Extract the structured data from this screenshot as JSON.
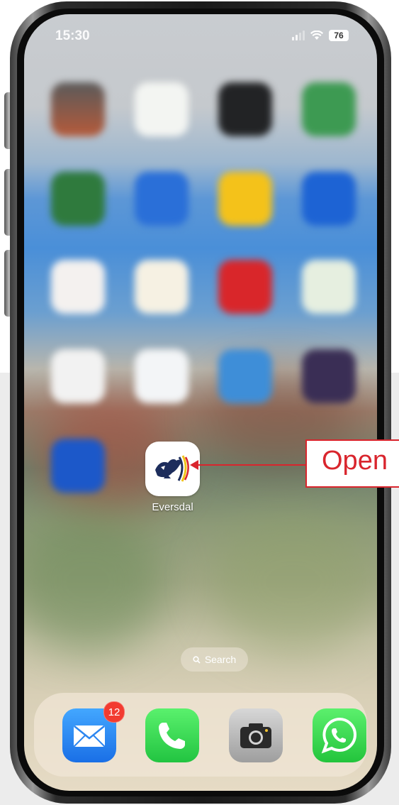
{
  "status_bar": {
    "time": "15:30",
    "battery": "76"
  },
  "home_screen": {
    "focused_app": {
      "label": "Eversdal"
    },
    "search_label": "Search"
  },
  "dock": {
    "apps": [
      {
        "icon": "mail-icon",
        "badge": "12"
      },
      {
        "icon": "phone-icon"
      },
      {
        "icon": "camera-icon"
      },
      {
        "icon": "whatsapp-icon"
      }
    ]
  },
  "annotation": {
    "text": "Open",
    "color": "#d9252d"
  }
}
